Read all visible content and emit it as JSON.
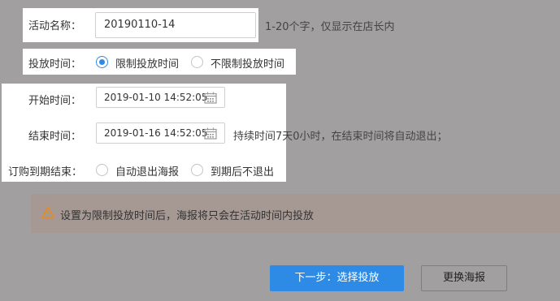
{
  "form": {
    "name_label": "活动名称：",
    "name_value": "20190110-14",
    "name_hint": "1-20个字，仅显示在店长内",
    "period_label": "投放时间：",
    "period_options": [
      {
        "label": "限制投放时间",
        "selected": true
      },
      {
        "label": "不限制投放时间",
        "selected": false
      }
    ],
    "start_label": "开始时间：",
    "start_value": "2019-01-10 14:52:05",
    "end_label": "结束时间：",
    "end_value": "2019-01-16 14:52:05",
    "duration_hint": "持续时间7天0小时，在结束时间将自动退出；",
    "expire_label": "订购到期结束：",
    "expire_options": [
      {
        "label": "自动退出海报",
        "selected": false
      },
      {
        "label": "到期后不退出",
        "selected": false
      }
    ]
  },
  "alert": {
    "text": "设置为限制投放时间后，海报将只会在活动时间内投放",
    "icon": "warning-icon",
    "color": "#f08c1c"
  },
  "buttons": {
    "next_label": "下一步：选择投放",
    "change_label": "更换海报"
  },
  "colors": {
    "overlay": "#a19fa0",
    "accent": "#2d8be6"
  }
}
